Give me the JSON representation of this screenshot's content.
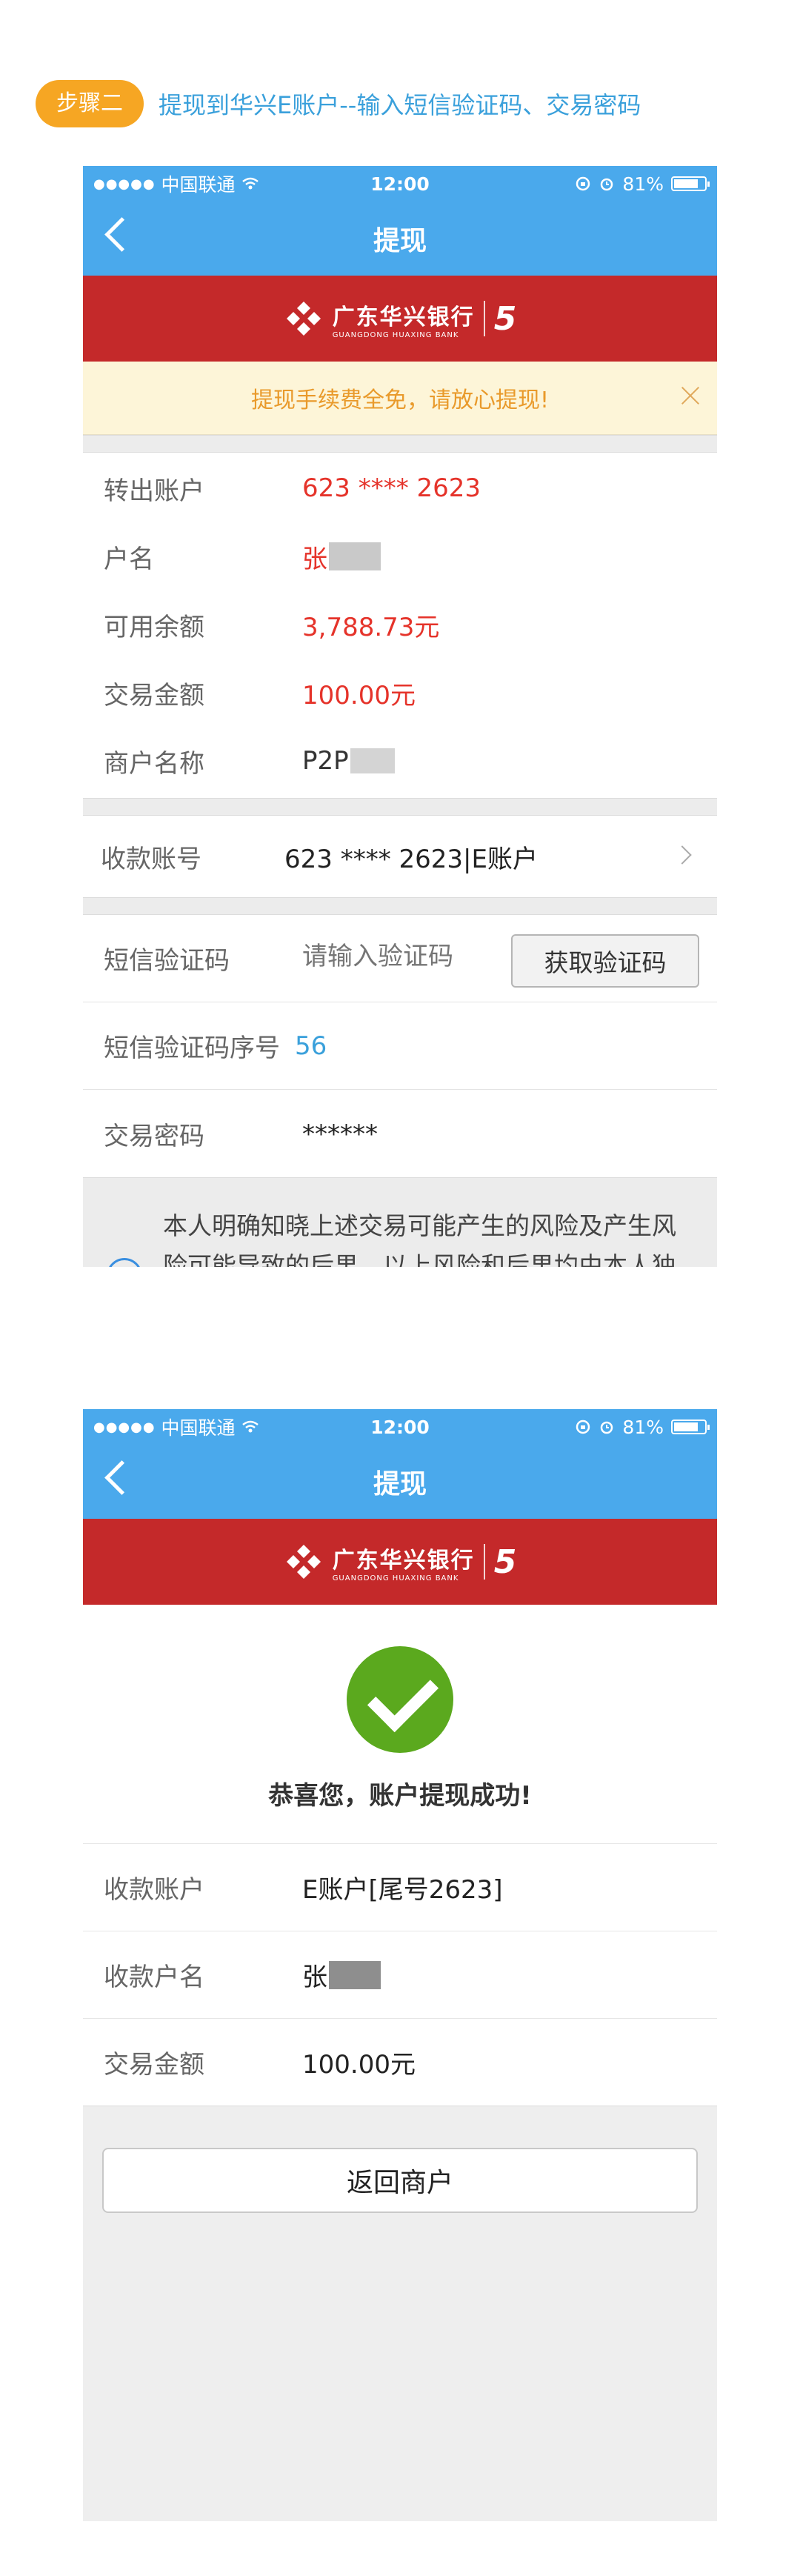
{
  "step": {
    "badge": "步骤二",
    "title": "提现到华兴E账户--输入短信验证码、交易密码"
  },
  "status_bar": {
    "dots": "●●●●●",
    "carrier": "中国联通",
    "time": "12:00",
    "battery": "81%",
    "battery_level": 0.81
  },
  "screen1": {
    "nav_title": "提现",
    "bank": {
      "name": "广东华兴银行",
      "name_en": "GUANGDONG HUAXING BANK",
      "number": "5"
    },
    "notice": "提现手续费全免，请放心提现!",
    "info": [
      {
        "label": "转出账户",
        "value": "623 **** 2623",
        "blur": false
      },
      {
        "label": "户名",
        "value": "张",
        "blur": true
      },
      {
        "label": "可用余额",
        "value": "3,788.73元",
        "blur": false
      },
      {
        "label": "交易金额",
        "value": "100.00元",
        "blur": false
      },
      {
        "label": "商户名称",
        "value": "P2P",
        "blur": true
      }
    ],
    "receive": {
      "label": "收款账号",
      "value": "623 **** 2623|E账户"
    },
    "sms": {
      "label": "短信验证码",
      "placeholder": "请输入验证码",
      "button": "获取验证码"
    },
    "sms_seq": {
      "label": "短信验证码序号",
      "value": "56"
    },
    "password": {
      "label": "交易密码",
      "value": "******"
    },
    "agreement": "本人明确知晓上述交易可能产生的风险及产生风险可能导致的后果。以上风险和后果均由本人独自承担，本人也已详细阅读并"
  },
  "screen2": {
    "nav_title": "提现",
    "success_text": "恭喜您，账户提现成功!",
    "results": [
      {
        "label": "收款账户",
        "value": "E账户[尾号2623]",
        "blur": false
      },
      {
        "label": "收款户名",
        "value": "张",
        "blur": true
      },
      {
        "label": "交易金额",
        "value": "100.00元",
        "blur": false
      }
    ],
    "return_button": "返回商户"
  },
  "colors": {
    "nav": "#4aa9ec",
    "bank_red": "#c4292a",
    "accent_red": "#e5332a",
    "orange": "#f6a623",
    "green": "#5ba91e",
    "link_blue": "#3aa0db"
  }
}
